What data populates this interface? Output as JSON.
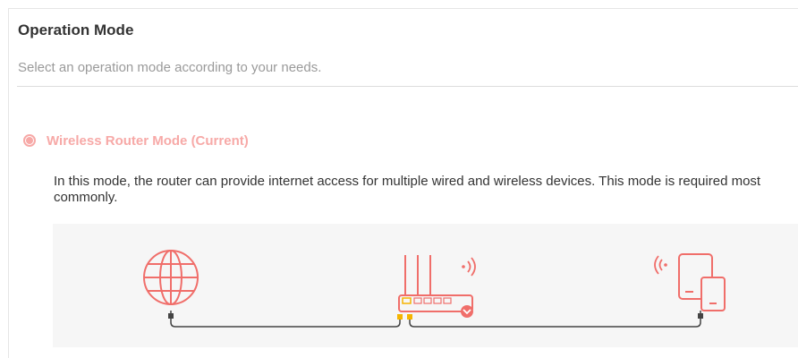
{
  "section": {
    "title": "Operation Mode",
    "subtitle": "Select an operation mode according to your needs."
  },
  "mode": {
    "label": "Wireless Router Mode (Current)",
    "selected": true,
    "description": "In this mode, the router can provide internet access for multiple wired and wireless devices. This mode is required most commonly."
  },
  "illustration": {
    "icons": [
      "globe-icon",
      "router-icon",
      "devices-icon"
    ],
    "colors": {
      "accent": "#f06e6a",
      "accent_light": "#f7a9a7",
      "port": "#f5b400",
      "cable": "#444444",
      "background": "#f6f6f6"
    }
  }
}
